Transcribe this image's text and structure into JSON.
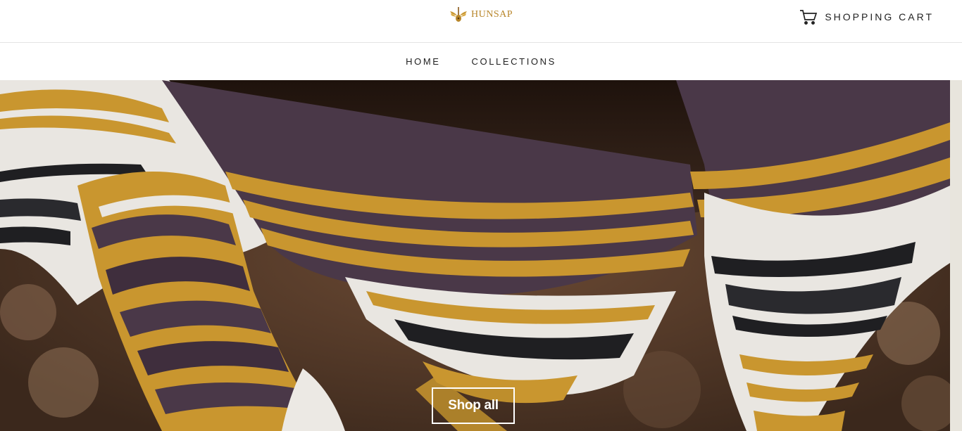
{
  "header": {
    "logo_text": "HUNSAP",
    "logo_icon": "winged-guitar-logo",
    "cart_label": "SHOPPING CART",
    "cart_icon": "cart-icon"
  },
  "nav": {
    "items": [
      {
        "label": "HOME"
      },
      {
        "label": "COLLECTIONS"
      }
    ]
  },
  "hero": {
    "image": "close-up of striped woven Mexican blanket with mustard, purple, black and white stripes",
    "button_label": "Shop all"
  },
  "colors": {
    "brand": "#b8862a",
    "text": "#222222",
    "border": "#e4e4e4",
    "mustard": "#c9962f",
    "purple": "#4a3848",
    "cream": "#e9e6e1"
  }
}
